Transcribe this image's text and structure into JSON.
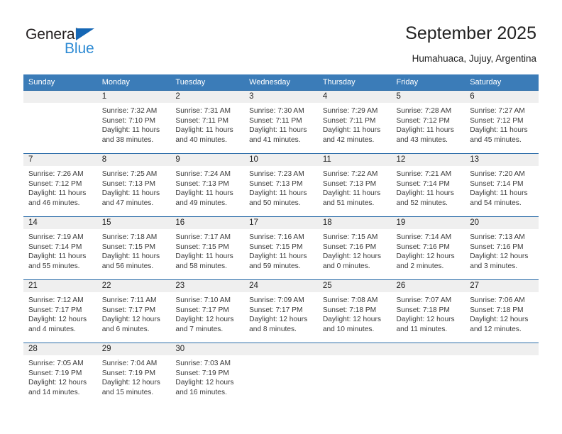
{
  "brand": {
    "name_part1": "General",
    "name_part2": "Blue",
    "triangle_color": "#1567b5",
    "blue_color": "#2e8bd4",
    "dark_color": "#231f20"
  },
  "header": {
    "title": "September 2025",
    "subtitle": "Humahuaca, Jujuy, Argentina"
  },
  "theme": {
    "header_row_bg": "#3b7cb8",
    "daynum_band_bg": "#efefef",
    "row_separator": "#2b6ca8",
    "cell_bg": "#ffffff",
    "text_color": "#3a3a3a"
  },
  "calendar": {
    "weekday_headers": [
      "Sunday",
      "Monday",
      "Tuesday",
      "Wednesday",
      "Thursday",
      "Friday",
      "Saturday"
    ],
    "weeks": [
      [
        {
          "day": "",
          "sunrise": "",
          "sunset": "",
          "daylight_line1": "",
          "daylight_line2": ""
        },
        {
          "day": "1",
          "sunrise": "Sunrise: 7:32 AM",
          "sunset": "Sunset: 7:10 PM",
          "daylight_line1": "Daylight: 11 hours",
          "daylight_line2": "and 38 minutes."
        },
        {
          "day": "2",
          "sunrise": "Sunrise: 7:31 AM",
          "sunset": "Sunset: 7:11 PM",
          "daylight_line1": "Daylight: 11 hours",
          "daylight_line2": "and 40 minutes."
        },
        {
          "day": "3",
          "sunrise": "Sunrise: 7:30 AM",
          "sunset": "Sunset: 7:11 PM",
          "daylight_line1": "Daylight: 11 hours",
          "daylight_line2": "and 41 minutes."
        },
        {
          "day": "4",
          "sunrise": "Sunrise: 7:29 AM",
          "sunset": "Sunset: 7:11 PM",
          "daylight_line1": "Daylight: 11 hours",
          "daylight_line2": "and 42 minutes."
        },
        {
          "day": "5",
          "sunrise": "Sunrise: 7:28 AM",
          "sunset": "Sunset: 7:12 PM",
          "daylight_line1": "Daylight: 11 hours",
          "daylight_line2": "and 43 minutes."
        },
        {
          "day": "6",
          "sunrise": "Sunrise: 7:27 AM",
          "sunset": "Sunset: 7:12 PM",
          "daylight_line1": "Daylight: 11 hours",
          "daylight_line2": "and 45 minutes."
        }
      ],
      [
        {
          "day": "7",
          "sunrise": "Sunrise: 7:26 AM",
          "sunset": "Sunset: 7:12 PM",
          "daylight_line1": "Daylight: 11 hours",
          "daylight_line2": "and 46 minutes."
        },
        {
          "day": "8",
          "sunrise": "Sunrise: 7:25 AM",
          "sunset": "Sunset: 7:13 PM",
          "daylight_line1": "Daylight: 11 hours",
          "daylight_line2": "and 47 minutes."
        },
        {
          "day": "9",
          "sunrise": "Sunrise: 7:24 AM",
          "sunset": "Sunset: 7:13 PM",
          "daylight_line1": "Daylight: 11 hours",
          "daylight_line2": "and 49 minutes."
        },
        {
          "day": "10",
          "sunrise": "Sunrise: 7:23 AM",
          "sunset": "Sunset: 7:13 PM",
          "daylight_line1": "Daylight: 11 hours",
          "daylight_line2": "and 50 minutes."
        },
        {
          "day": "11",
          "sunrise": "Sunrise: 7:22 AM",
          "sunset": "Sunset: 7:13 PM",
          "daylight_line1": "Daylight: 11 hours",
          "daylight_line2": "and 51 minutes."
        },
        {
          "day": "12",
          "sunrise": "Sunrise: 7:21 AM",
          "sunset": "Sunset: 7:14 PM",
          "daylight_line1": "Daylight: 11 hours",
          "daylight_line2": "and 52 minutes."
        },
        {
          "day": "13",
          "sunrise": "Sunrise: 7:20 AM",
          "sunset": "Sunset: 7:14 PM",
          "daylight_line1": "Daylight: 11 hours",
          "daylight_line2": "and 54 minutes."
        }
      ],
      [
        {
          "day": "14",
          "sunrise": "Sunrise: 7:19 AM",
          "sunset": "Sunset: 7:14 PM",
          "daylight_line1": "Daylight: 11 hours",
          "daylight_line2": "and 55 minutes."
        },
        {
          "day": "15",
          "sunrise": "Sunrise: 7:18 AM",
          "sunset": "Sunset: 7:15 PM",
          "daylight_line1": "Daylight: 11 hours",
          "daylight_line2": "and 56 minutes."
        },
        {
          "day": "16",
          "sunrise": "Sunrise: 7:17 AM",
          "sunset": "Sunset: 7:15 PM",
          "daylight_line1": "Daylight: 11 hours",
          "daylight_line2": "and 58 minutes."
        },
        {
          "day": "17",
          "sunrise": "Sunrise: 7:16 AM",
          "sunset": "Sunset: 7:15 PM",
          "daylight_line1": "Daylight: 11 hours",
          "daylight_line2": "and 59 minutes."
        },
        {
          "day": "18",
          "sunrise": "Sunrise: 7:15 AM",
          "sunset": "Sunset: 7:16 PM",
          "daylight_line1": "Daylight: 12 hours",
          "daylight_line2": "and 0 minutes."
        },
        {
          "day": "19",
          "sunrise": "Sunrise: 7:14 AM",
          "sunset": "Sunset: 7:16 PM",
          "daylight_line1": "Daylight: 12 hours",
          "daylight_line2": "and 2 minutes."
        },
        {
          "day": "20",
          "sunrise": "Sunrise: 7:13 AM",
          "sunset": "Sunset: 7:16 PM",
          "daylight_line1": "Daylight: 12 hours",
          "daylight_line2": "and 3 minutes."
        }
      ],
      [
        {
          "day": "21",
          "sunrise": "Sunrise: 7:12 AM",
          "sunset": "Sunset: 7:17 PM",
          "daylight_line1": "Daylight: 12 hours",
          "daylight_line2": "and 4 minutes."
        },
        {
          "day": "22",
          "sunrise": "Sunrise: 7:11 AM",
          "sunset": "Sunset: 7:17 PM",
          "daylight_line1": "Daylight: 12 hours",
          "daylight_line2": "and 6 minutes."
        },
        {
          "day": "23",
          "sunrise": "Sunrise: 7:10 AM",
          "sunset": "Sunset: 7:17 PM",
          "daylight_line1": "Daylight: 12 hours",
          "daylight_line2": "and 7 minutes."
        },
        {
          "day": "24",
          "sunrise": "Sunrise: 7:09 AM",
          "sunset": "Sunset: 7:17 PM",
          "daylight_line1": "Daylight: 12 hours",
          "daylight_line2": "and 8 minutes."
        },
        {
          "day": "25",
          "sunrise": "Sunrise: 7:08 AM",
          "sunset": "Sunset: 7:18 PM",
          "daylight_line1": "Daylight: 12 hours",
          "daylight_line2": "and 10 minutes."
        },
        {
          "day": "26",
          "sunrise": "Sunrise: 7:07 AM",
          "sunset": "Sunset: 7:18 PM",
          "daylight_line1": "Daylight: 12 hours",
          "daylight_line2": "and 11 minutes."
        },
        {
          "day": "27",
          "sunrise": "Sunrise: 7:06 AM",
          "sunset": "Sunset: 7:18 PM",
          "daylight_line1": "Daylight: 12 hours",
          "daylight_line2": "and 12 minutes."
        }
      ],
      [
        {
          "day": "28",
          "sunrise": "Sunrise: 7:05 AM",
          "sunset": "Sunset: 7:19 PM",
          "daylight_line1": "Daylight: 12 hours",
          "daylight_line2": "and 14 minutes."
        },
        {
          "day": "29",
          "sunrise": "Sunrise: 7:04 AM",
          "sunset": "Sunset: 7:19 PM",
          "daylight_line1": "Daylight: 12 hours",
          "daylight_line2": "and 15 minutes."
        },
        {
          "day": "30",
          "sunrise": "Sunrise: 7:03 AM",
          "sunset": "Sunset: 7:19 PM",
          "daylight_line1": "Daylight: 12 hours",
          "daylight_line2": "and 16 minutes."
        },
        {
          "day": "",
          "sunrise": "",
          "sunset": "",
          "daylight_line1": "",
          "daylight_line2": ""
        },
        {
          "day": "",
          "sunrise": "",
          "sunset": "",
          "daylight_line1": "",
          "daylight_line2": ""
        },
        {
          "day": "",
          "sunrise": "",
          "sunset": "",
          "daylight_line1": "",
          "daylight_line2": ""
        },
        {
          "day": "",
          "sunrise": "",
          "sunset": "",
          "daylight_line1": "",
          "daylight_line2": ""
        }
      ]
    ]
  }
}
